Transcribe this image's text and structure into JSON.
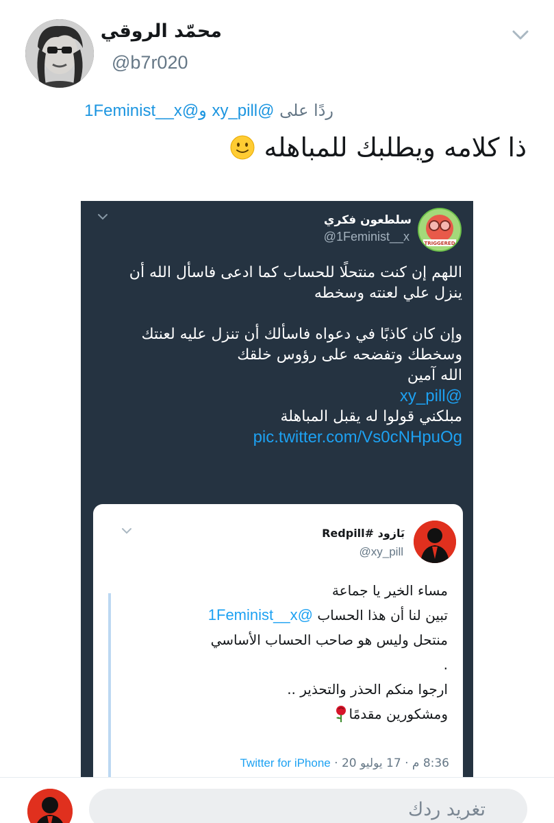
{
  "tweet": {
    "author_name": "محمّد الروقي",
    "author_handle": "@b7r020",
    "reply_prefix": "ردًا على",
    "reply_to_1": "@xy_pill",
    "reply_and": "و",
    "reply_to_2": "@1Feminist__x",
    "text": "ذا كلامه ويطلبك للمباهله",
    "emoji_icon": "slightly-smiling-face-icon"
  },
  "embedded": {
    "author_name": "سلطعون فكري",
    "author_handle": "@1Feminist__x",
    "avatar_label": "TRIGGERED",
    "lines_1": [
      "اللهم إن كنت منتحلًا للحساب كما ادعى فاسأل الله أن",
      "ينزل علي لعنته وسخطه"
    ],
    "lines_2": [
      "وإن كان كاذبًا في دعواه فاسألك أن تنزل عليه لعنتك",
      "وسخطك وتفضحه على رؤوس خلقك",
      "الله آمين"
    ],
    "mention": "@xy_pill",
    "line_3": "مبلكني قولوا له يقبل المباهلة",
    "pic_link": "pic.twitter.com/Vs0cNHpuOg",
    "quote": {
      "author_name": "بَازود #Redpill",
      "author_handle": "@xy_pill",
      "line_1": "مساء الخير يا جماعة",
      "line_2_prefix": "تبين لنا أن هذا الحساب",
      "line_2_mention": "@1Feminist__x",
      "line_3": "منتحل وليس هو صاحب الحساب الأساسي",
      "line_4": ".",
      "line_5": "ارجوا منكم الحذر والتحذير ..",
      "line_6": "ومشكورين مقدمًا",
      "meta_time": "8:36 م · 17 يوليو 20 ·",
      "meta_source": "Twitter for iPhone"
    }
  },
  "compose": {
    "placeholder": "تغريد ردك"
  },
  "colors": {
    "link": "#1b95e0",
    "dark_bg": "#253341",
    "muted": "#657786"
  }
}
